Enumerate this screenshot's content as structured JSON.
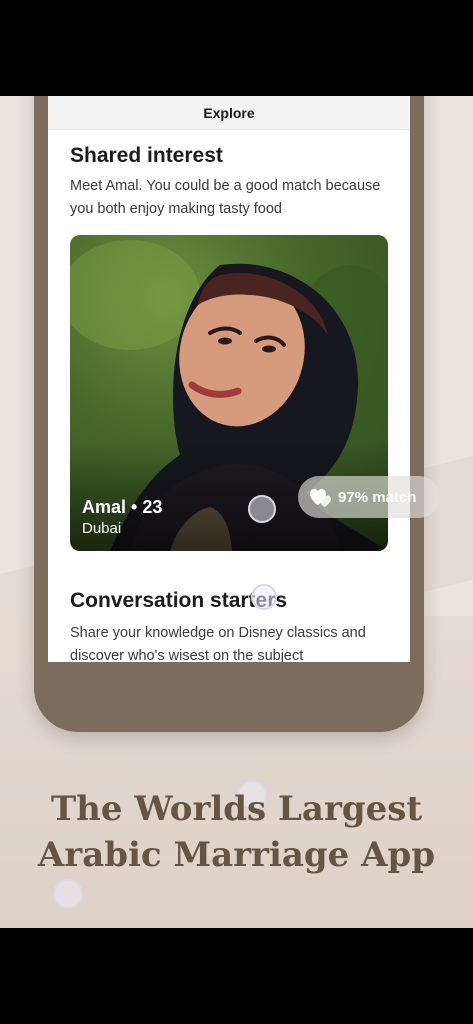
{
  "screen": {
    "header_title": "Explore"
  },
  "shared_interest": {
    "title": "Shared interest",
    "description": "Meet Amal. You could be a good match because you both enjoy making tasty food"
  },
  "profile": {
    "name_age": "Amal • 23",
    "city": "Dubai",
    "match": "97% match"
  },
  "conversation": {
    "title": "Conversation starters",
    "description": "Share your knowledge on Disney classics and discover who's wisest on the subject"
  },
  "tagline": {
    "line1": "The Worlds Largest",
    "line2": "Arabic Marriage App"
  },
  "colors": {
    "background": "#ece3dd",
    "phone_frame": "#7b6c5d",
    "tagline": "#665444"
  },
  "icons": {
    "match": "hearts-icon"
  }
}
